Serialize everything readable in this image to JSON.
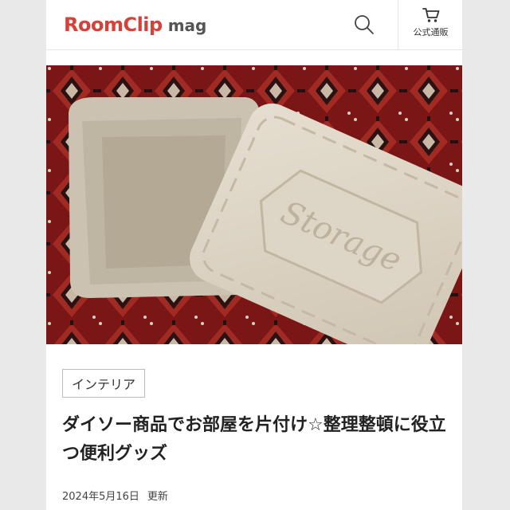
{
  "header": {
    "logo_main": "RoomClip",
    "logo_sub": "mag",
    "search_icon": "search-icon",
    "shop_icon": "cart-icon",
    "shop_label": "公式通販",
    "brand_color": "#d4423a"
  },
  "hero": {
    "embossed_text": "Storage"
  },
  "article": {
    "category": "インテリア",
    "title": "ダイソー商品でお部屋を片付け☆整理整頓に役立つ便利グッズ",
    "date": "2024年5月16日",
    "date_suffix": "更新"
  }
}
